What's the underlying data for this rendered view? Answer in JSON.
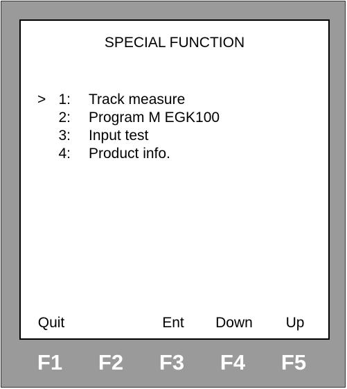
{
  "screen": {
    "title": "SPECIAL FUNCTION",
    "cursor": ">",
    "menu": [
      {
        "num": "1:",
        "label": "Track measure"
      },
      {
        "num": "2:",
        "label": "Program M EGK100"
      },
      {
        "num": "3:",
        "label": "Input test"
      },
      {
        "num": "4:",
        "label": "Product info."
      }
    ],
    "softkeys": [
      "Quit",
      "",
      "Ent",
      "Down",
      "Up"
    ]
  },
  "function_keys": [
    "F1",
    "F2",
    "F3",
    "F4",
    "F5"
  ]
}
